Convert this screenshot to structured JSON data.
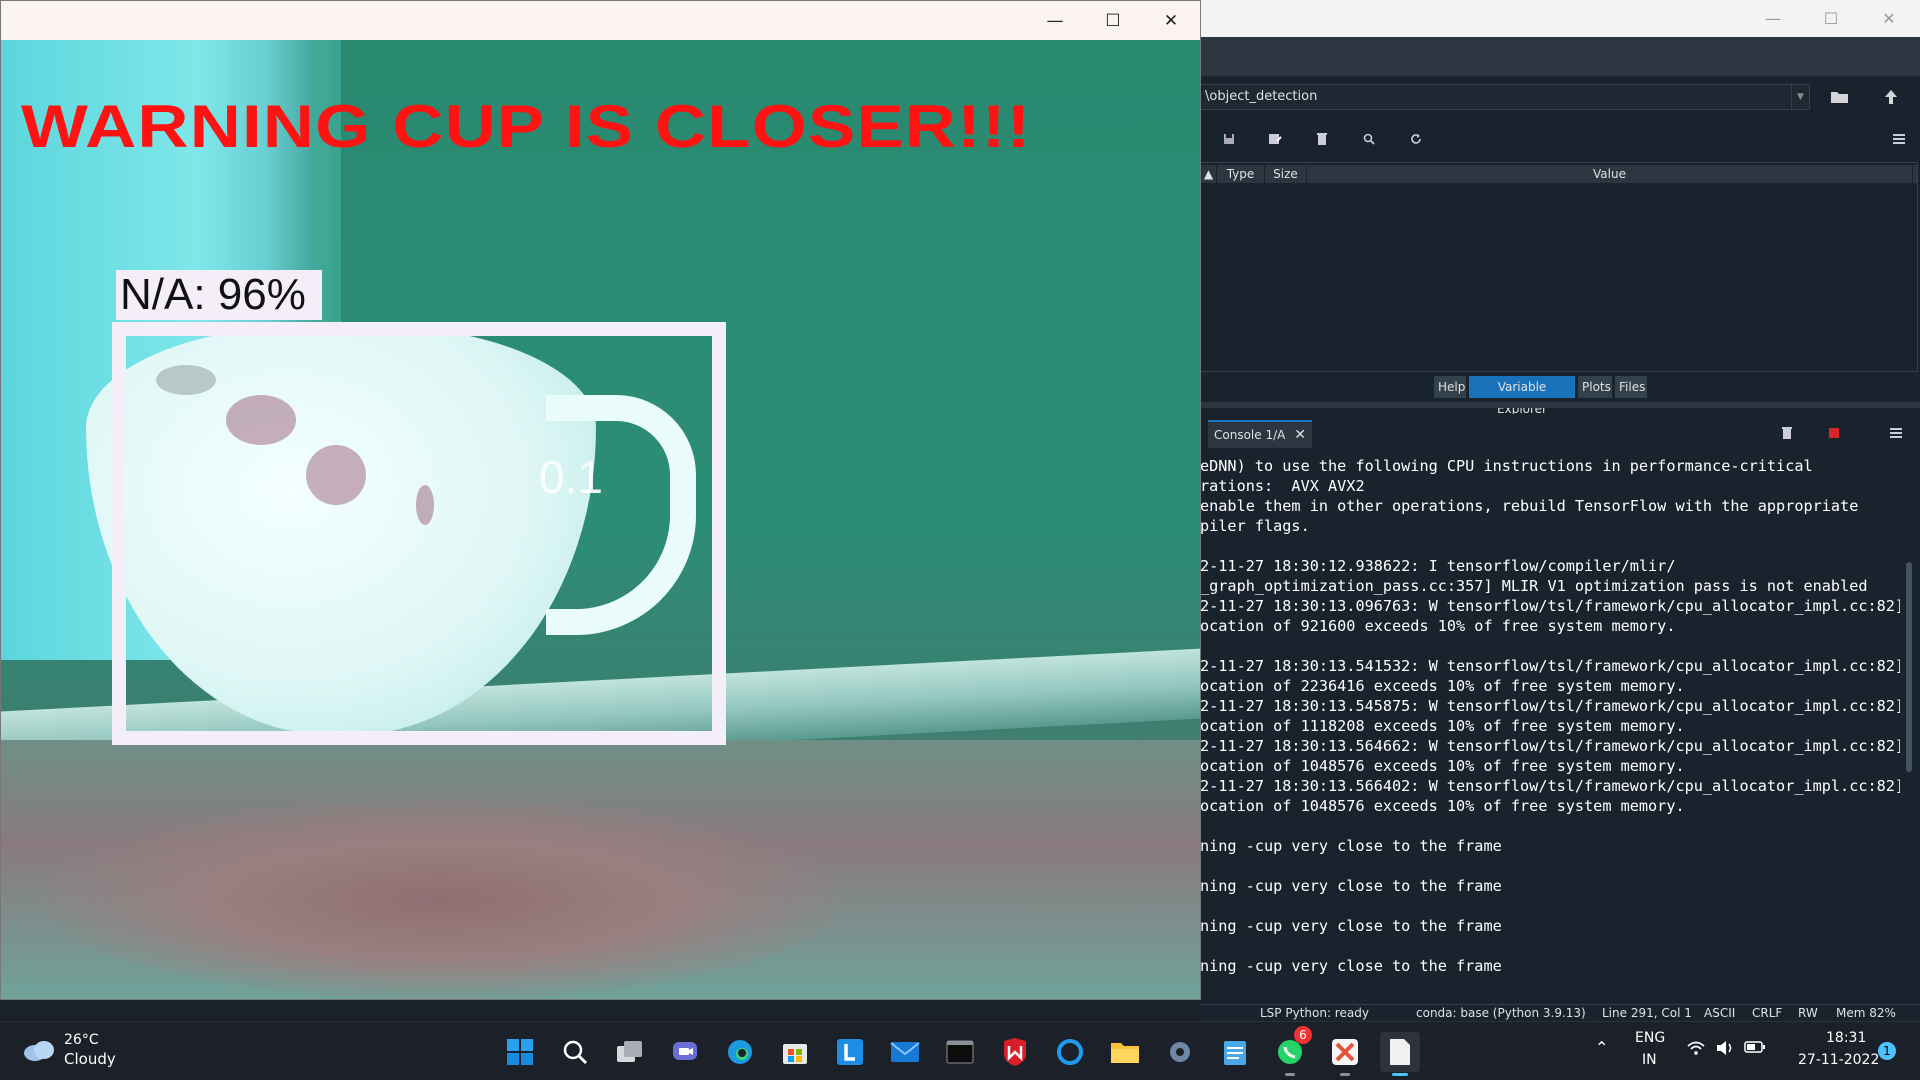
{
  "camera_window": {
    "warning_text": "WARNING CUP IS CLOSER!!!",
    "detection_label": "N/A: 96%",
    "object_id": "0.1",
    "box_color": "#f3eef7",
    "warning_color": "#ff1212"
  },
  "spyder": {
    "path": "\\object_detection",
    "variable_explorer": {
      "columns": [
        "Type",
        "Size",
        "Value"
      ]
    },
    "pane_tabs": [
      "Help",
      "Variable Explorer",
      "Plots",
      "Files"
    ],
    "active_pane_tab": "Variable Explorer",
    "console_tab_label": "Console 1/A",
    "console_lines": [
      "eDNN) to use the following CPU instructions in performance-critical",
      "rations:  AVX AVX2",
      "enable them in other operations, rebuild TensorFlow with the appropriate",
      "piler flags.",
      "",
      "2-11-27 18:30:12.938622: I tensorflow/compiler/mlir/",
      "_graph_optimization_pass.cc:357] MLIR V1 optimization pass is not enabled",
      "2-11-27 18:30:13.096763: W tensorflow/tsl/framework/cpu_allocator_impl.cc:82]",
      "ocation of 921600 exceeds 10% of free system memory.",
      "",
      "2-11-27 18:30:13.541532: W tensorflow/tsl/framework/cpu_allocator_impl.cc:82]",
      "ocation of 2236416 exceeds 10% of free system memory.",
      "2-11-27 18:30:13.545875: W tensorflow/tsl/framework/cpu_allocator_impl.cc:82]",
      "ocation of 1118208 exceeds 10% of free system memory.",
      "2-11-27 18:30:13.564662: W tensorflow/tsl/framework/cpu_allocator_impl.cc:82]",
      "ocation of 1048576 exceeds 10% of free system memory.",
      "2-11-27 18:30:13.566402: W tensorflow/tsl/framework/cpu_allocator_impl.cc:82]",
      "ocation of 1048576 exceeds 10% of free system memory.",
      "",
      "ning -cup very close to the frame",
      "",
      "ning -cup very close to the frame",
      "",
      "ning -cup very close to the frame",
      "",
      "ning -cup very close to the frame"
    ],
    "status": {
      "lsp": "LSP Python: ready",
      "conda": "conda: base (Python 3.9.13)",
      "position": "Line 291, Col 1",
      "encoding": "ASCII",
      "eol": "CRLF",
      "rw": "RW",
      "mem": "Mem 82%"
    }
  },
  "taskbar": {
    "weather": {
      "temp": "26°C",
      "condition": "Cloudy"
    },
    "apps": [
      "start-icon",
      "search-icon",
      "task-view-icon",
      "teams-chat-icon",
      "edge-icon",
      "store-icon",
      "l-app-icon",
      "mail-icon",
      "terminal-icon",
      "mcafee-icon",
      "cortana-icon",
      "file-explorer-icon",
      "settings-icon",
      "notepad-icon",
      "whatsapp-icon",
      "xampp-icon",
      "document-icon"
    ],
    "whatsapp_badge": "6",
    "language": "ENG",
    "region": "IN",
    "time": "18:31",
    "date": "27-11-2022",
    "notification_count": "1"
  }
}
